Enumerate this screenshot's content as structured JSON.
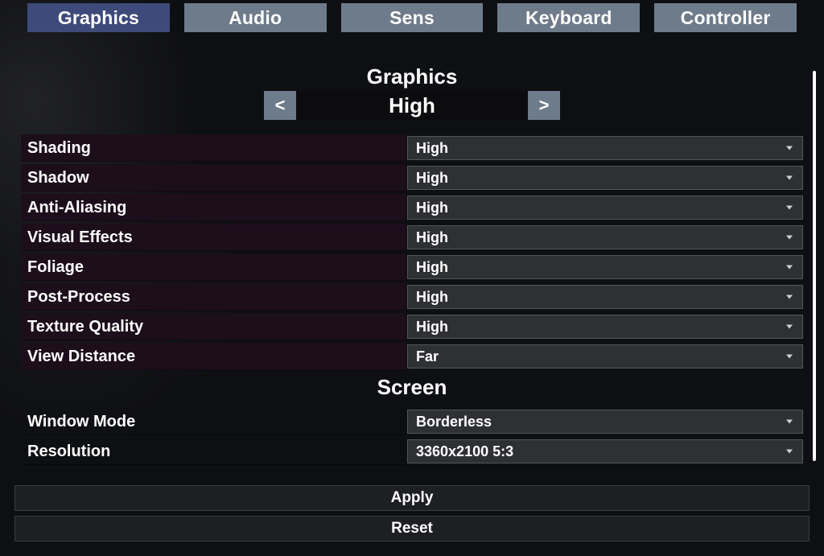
{
  "tabs": {
    "graphics": "Graphics",
    "audio": "Audio",
    "sens": "Sens",
    "keyboard": "Keyboard",
    "controller": "Controller"
  },
  "sections": {
    "graphics_title": "Graphics",
    "screen_title": "Screen"
  },
  "preset": {
    "prev_glyph": "<",
    "next_glyph": ">",
    "value": "High"
  },
  "settings": {
    "shading": {
      "label": "Shading",
      "value": "High"
    },
    "shadow": {
      "label": "Shadow",
      "value": "High"
    },
    "anti_aliasing": {
      "label": "Anti-Aliasing",
      "value": "High"
    },
    "visual_effects": {
      "label": "Visual Effects",
      "value": "High"
    },
    "foliage": {
      "label": "Foliage",
      "value": "High"
    },
    "post_process": {
      "label": "Post-Process",
      "value": "High"
    },
    "texture_quality": {
      "label": "Texture Quality",
      "value": "High"
    },
    "view_distance": {
      "label": "View Distance",
      "value": "Far"
    }
  },
  "screen": {
    "window_mode": {
      "label": "Window Mode",
      "value": "Borderless"
    },
    "resolution": {
      "label": "Resolution",
      "value": "3360x2100   5:3"
    }
  },
  "buttons": {
    "apply": "Apply",
    "reset": "Reset"
  }
}
